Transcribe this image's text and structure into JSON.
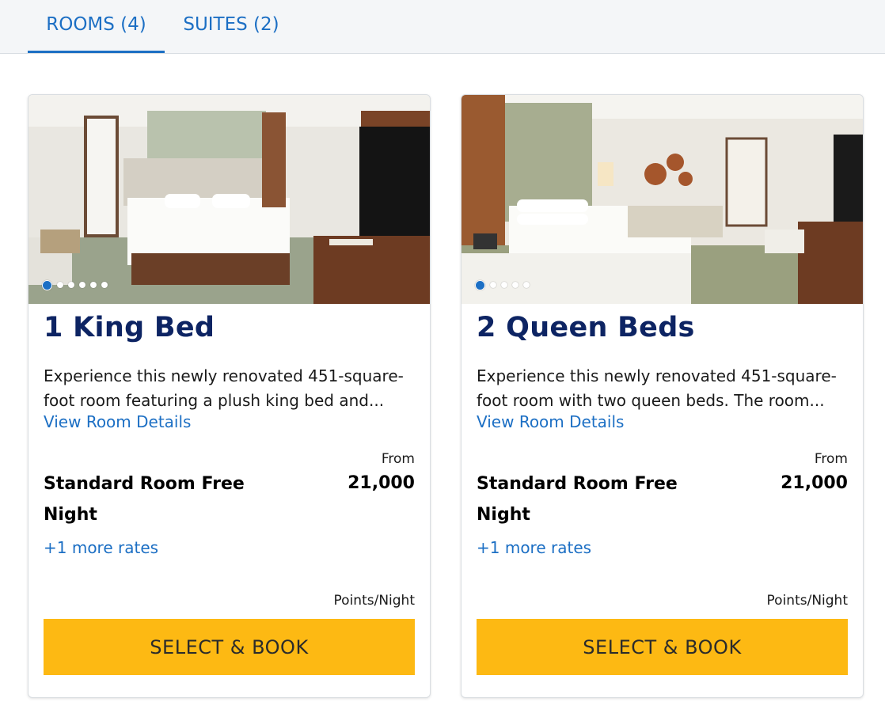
{
  "tabs": [
    {
      "label": "ROOMS (4)",
      "active": true
    },
    {
      "label": "SUITES (2)",
      "active": false
    }
  ],
  "colors": {
    "accent": "#1c6fc4",
    "title": "#0d2463",
    "button": "#fdb913"
  },
  "rooms": [
    {
      "title": "1 King Bed",
      "description": "Experience this newly renovated 451-square-foot room featuring a plush king bed and...",
      "details_link": "View Room Details",
      "from_label": "From",
      "rate_name": "Standard Room Free Night",
      "points": "21,000",
      "more_rates": "+1 more rates",
      "per_night": "Points/Night",
      "button": "SELECT & BOOK",
      "photo_count": 6,
      "active_photo": 1
    },
    {
      "title": "2 Queen Beds",
      "description": "Experience this newly renovated 451-square-foot room with two queen beds. The room...",
      "details_link": "View Room Details",
      "from_label": "From",
      "rate_name": "Standard Room Free Night",
      "points": "21,000",
      "more_rates": "+1 more rates",
      "per_night": "Points/Night",
      "button": "SELECT & BOOK",
      "photo_count": 5,
      "active_photo": 1
    }
  ]
}
